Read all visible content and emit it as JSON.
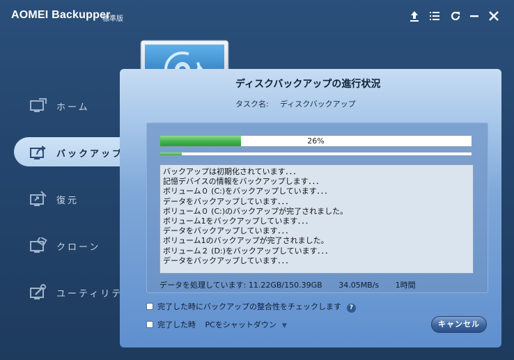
{
  "window": {
    "app_title": "AOMEI Backupper",
    "edition": "標準版"
  },
  "titlebar_icons": [
    "upgrade-icon",
    "menu-icon",
    "refresh-icon",
    "minimize-icon",
    "close-icon"
  ],
  "sidebar": {
    "items": [
      {
        "label": "ホーム",
        "icon": "home-icon",
        "active": false
      },
      {
        "label": "バックアップ",
        "icon": "backup-icon",
        "active": true
      },
      {
        "label": "復元",
        "icon": "restore-icon",
        "active": false
      },
      {
        "label": "クローン",
        "icon": "clone-icon",
        "active": false
      },
      {
        "label": "ユーティリティ",
        "icon": "utilities-icon",
        "active": false
      }
    ]
  },
  "main": {
    "title": "ディスクバックアップの進行状況",
    "task_label": "タスク名:",
    "task_name": "ディスクバックアップ",
    "progress_percent": 26,
    "progress_text": "26%",
    "secondary_progress_percent": 7,
    "log_lines": [
      "バックアップは初期化されています．．．",
      "記憶デバイスの情報をバックアップします．．．",
      "ボリューム０ (C:)をバックアップしています．．．",
      "データをバックアップしています．．．",
      "ボリューム０ (C:)のバックアップが完了されました。",
      "ボリューム1をバックアップしています．．．",
      "データをバックアップしています．．．",
      "ボリューム1のバックアップが完了されました。",
      "ボリューム２ (D:)をバックアップしています．．．",
      "データをバックアップしています．．．"
    ],
    "stats": {
      "processed": "データを処理しています: 11.22GB/150.39GB",
      "speed": "34.05MB/s",
      "remaining": "1時間"
    },
    "option_verify": "完了した時にバックアップの整合性をチェックします",
    "option_shutdown_prefix": "完了した時",
    "option_shutdown_select": "PCをシャットダウン",
    "cancel_label": "キャンセル"
  }
}
